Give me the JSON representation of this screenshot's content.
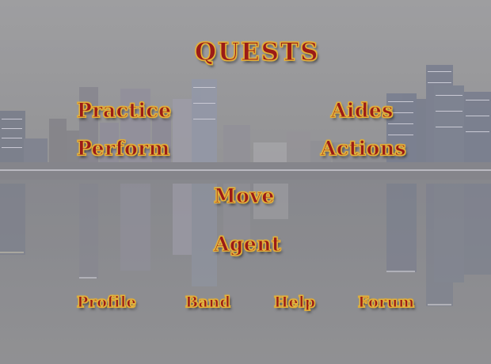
{
  "menu": {
    "title": "QUESTS",
    "practice": "Practice",
    "aides": "Aides",
    "perform": "Perform",
    "actions": "Actions",
    "move": "Move",
    "agent": "Agent"
  },
  "footer": {
    "profile": "Profile",
    "band": "Band",
    "help": "Help",
    "forum": "Forum"
  },
  "colors": {
    "link_text": "#9b1b17",
    "link_outline": "#e3b43c",
    "haze": "#8f8f90",
    "water": "#7f8086"
  }
}
